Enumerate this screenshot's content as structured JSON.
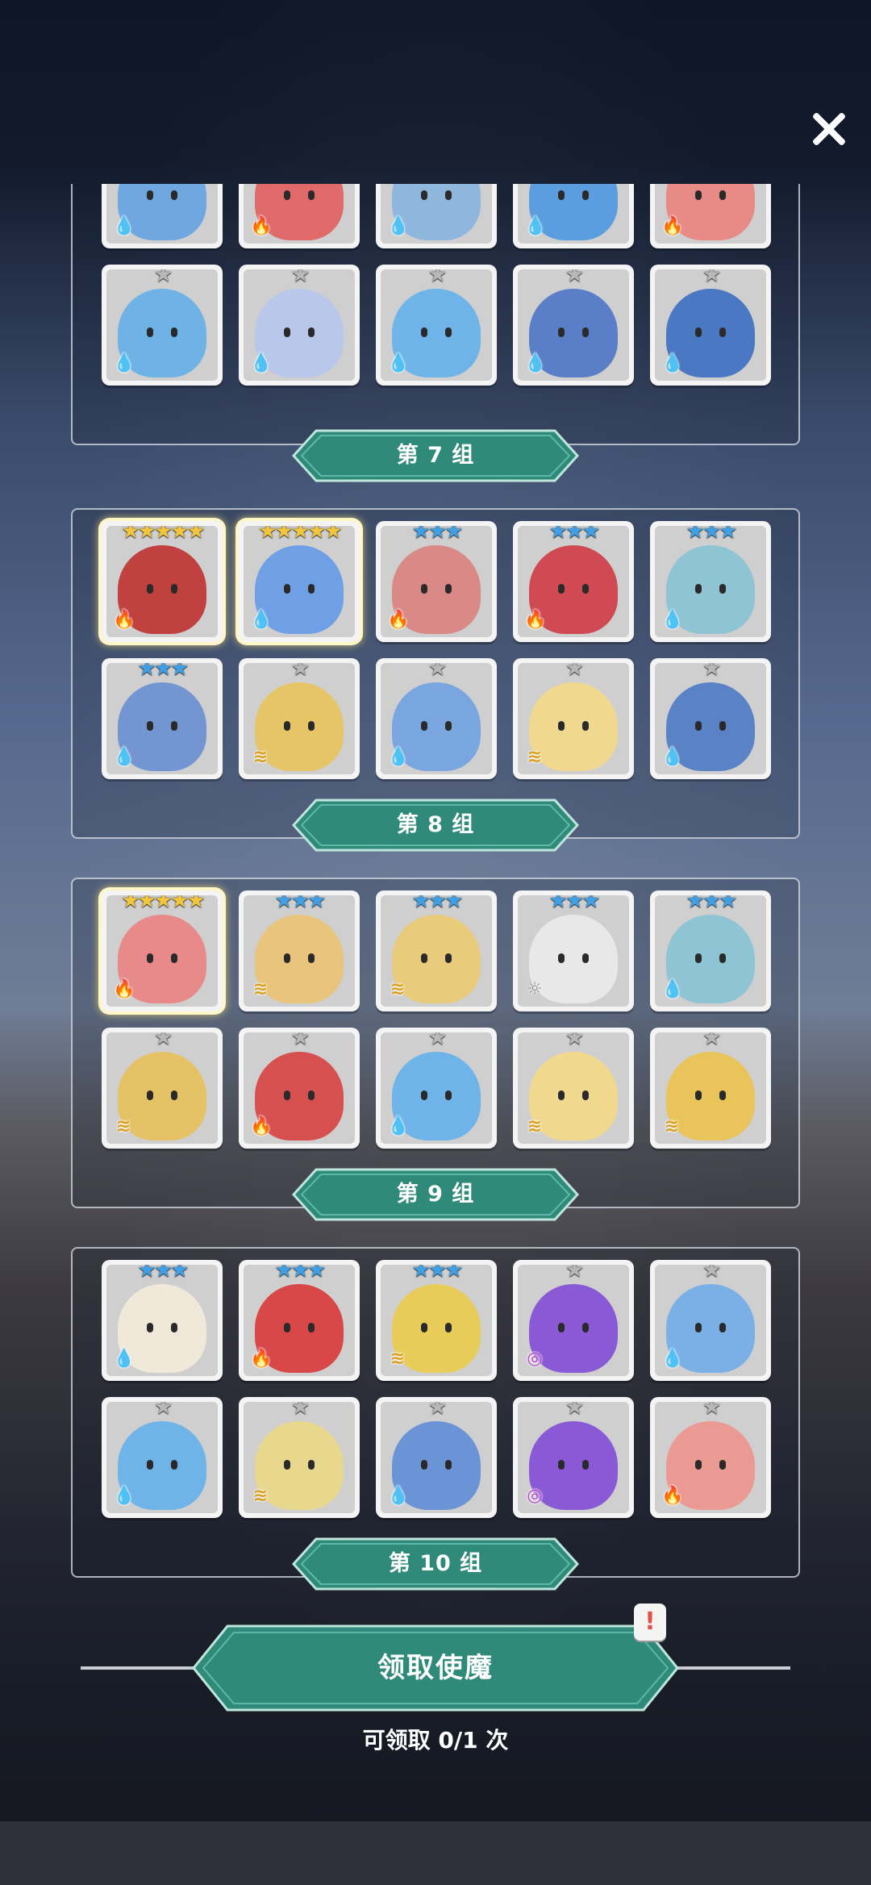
{
  "close_label": "✕",
  "groups": [
    {
      "label": "第 7 组",
      "rows": [
        [
          {
            "name": "clock-monster",
            "stars": 0,
            "elem": "water",
            "color": "#6fa8e0",
            "partial": true
          },
          {
            "name": "red-fuzzball",
            "stars": 0,
            "elem": "fire",
            "color": "#e06a6a",
            "partial": true
          },
          {
            "name": "mummy",
            "stars": 0,
            "elem": "water",
            "color": "#8fb6dc",
            "partial": true
          },
          {
            "name": "blue-spiky",
            "stars": 0,
            "elem": "water",
            "color": "#5a9ee0",
            "partial": true
          },
          {
            "name": "red-worm",
            "stars": 0,
            "elem": "fire",
            "color": "#e88a86",
            "partial": true
          }
        ],
        [
          {
            "name": "blue-dino",
            "stars": 1,
            "elem": "water",
            "color": "#6fb2e6"
          },
          {
            "name": "ghost",
            "stars": 1,
            "elem": "water",
            "color": "#b9c8ea"
          },
          {
            "name": "blue-bear",
            "stars": 1,
            "elem": "water",
            "color": "#6fb4e8"
          },
          {
            "name": "witch-girl",
            "stars": 1,
            "elem": "water",
            "color": "#5a7ec8"
          },
          {
            "name": "blue-golem",
            "stars": 1,
            "elem": "water",
            "color": "#4b78c2"
          }
        ]
      ]
    },
    {
      "label": "第 8 组",
      "rows": [
        [
          {
            "name": "red-book",
            "stars": 5,
            "elem": "fire",
            "color": "#c0413f",
            "gold": true
          },
          {
            "name": "ice-queen",
            "stars": 5,
            "elem": "water",
            "color": "#6fa0e6",
            "gold": true
          },
          {
            "name": "dragon-girl",
            "stars": 3,
            "elem": "fire",
            "color": "#d98a86"
          },
          {
            "name": "red-hood",
            "stars": 3,
            "elem": "fire",
            "color": "#cf4a52"
          },
          {
            "name": "skull-witch",
            "stars": 3,
            "elem": "water",
            "color": "#8fc4d4"
          }
        ],
        [
          {
            "name": "blue-robot",
            "stars": 3,
            "elem": "water",
            "color": "#7396d2"
          },
          {
            "name": "banana-cactus",
            "stars": 1,
            "elem": "wind",
            "color": "#e6c468"
          },
          {
            "name": "blue-slime",
            "stars": 1,
            "elem": "water",
            "color": "#7aa6e0"
          },
          {
            "name": "flower-girl",
            "stars": 1,
            "elem": "wind",
            "color": "#f0d98e"
          },
          {
            "name": "card-soldier",
            "stars": 1,
            "elem": "water",
            "color": "#5a82c6"
          }
        ]
      ]
    },
    {
      "label": "第 9 组",
      "rows": [
        [
          {
            "name": "pink-fox",
            "stars": 5,
            "elem": "fire",
            "color": "#e88a8a",
            "gold": true
          },
          {
            "name": "unicorn-knight",
            "stars": 3,
            "elem": "wind",
            "color": "#e8c47c"
          },
          {
            "name": "golden-priest",
            "stars": 3,
            "elem": "wind",
            "color": "#e8cc7c"
          },
          {
            "name": "white-knight",
            "stars": 3,
            "elem": "light",
            "color": "#e8e8e8"
          },
          {
            "name": "skull-witch",
            "stars": 3,
            "elem": "water",
            "color": "#8fc4d4"
          }
        ],
        [
          {
            "name": "yellow-fuzzball",
            "stars": 1,
            "elem": "wind",
            "color": "#e6c266"
          },
          {
            "name": "red-coral",
            "stars": 1,
            "elem": "fire",
            "color": "#d65050"
          },
          {
            "name": "blue-bear",
            "stars": 1,
            "elem": "water",
            "color": "#6fb4e8"
          },
          {
            "name": "flower-girl",
            "stars": 1,
            "elem": "wind",
            "color": "#f0d98e"
          },
          {
            "name": "winged-warrior",
            "stars": 1,
            "elem": "wind",
            "color": "#e8c45a"
          }
        ]
      ]
    },
    {
      "label": "第 10 组",
      "rows": [
        [
          {
            "name": "white-ninja",
            "stars": 3,
            "elem": "water",
            "color": "#f0e8d8"
          },
          {
            "name": "red-antler",
            "stars": 3,
            "elem": "fire",
            "color": "#d84848"
          },
          {
            "name": "yellow-antler",
            "stars": 3,
            "elem": "wind",
            "color": "#e8cc5a"
          },
          {
            "name": "purple-fuzzball",
            "stars": 1,
            "elem": "dark",
            "color": "#8a5ad6"
          },
          {
            "name": "blue-cactus",
            "stars": 1,
            "elem": "water",
            "color": "#7ab0e6"
          }
        ],
        [
          {
            "name": "blue-bear",
            "stars": 1,
            "elem": "water",
            "color": "#6fb4e8"
          },
          {
            "name": "turban-cat",
            "stars": 1,
            "elem": "wind",
            "color": "#e8d88e"
          },
          {
            "name": "goggle-kid",
            "stars": 1,
            "elem": "water",
            "color": "#6a94d6"
          },
          {
            "name": "purple-witch",
            "stars": 1,
            "elem": "dark",
            "color": "#8a5ad6"
          },
          {
            "name": "pink-warrior",
            "stars": 1,
            "elem": "fire",
            "color": "#ea9a92"
          }
        ]
      ]
    }
  ],
  "elements": {
    "water": {
      "glyph": "💧",
      "color": "#2f74d8"
    },
    "fire": {
      "glyph": "🔥",
      "color": "#e2533a"
    },
    "wind": {
      "glyph": "≋",
      "color": "#d9a020"
    },
    "light": {
      "glyph": "☼",
      "color": "#888888"
    },
    "dark": {
      "glyph": "◎",
      "color": "#b040c8"
    }
  },
  "star_colors": {
    "1": "#b8b8b8",
    "3": "#3fa0e8",
    "5": "#f2c53a"
  },
  "claim_button_label": "领取使魔",
  "alert_glyph": "!",
  "claim_count_text": "可领取 0/1 次",
  "accent_color": "#2f8a7a"
}
